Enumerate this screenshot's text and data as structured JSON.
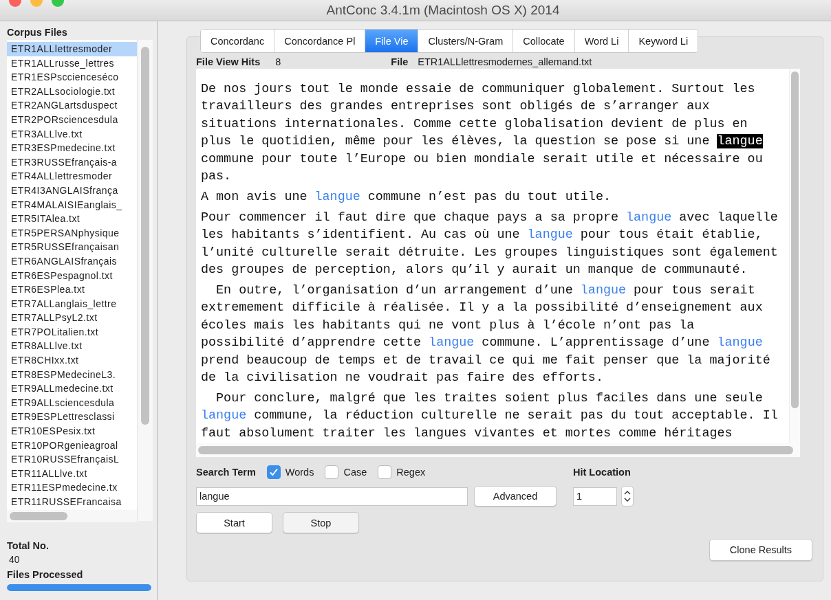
{
  "window": {
    "title": "AntConc 3.4.1m (Macintosh OS X) 2014"
  },
  "corpus_files": {
    "heading": "Corpus Files",
    "items": [
      {
        "name": "ETR1ALLlettresmoder",
        "selected": true
      },
      {
        "name": "ETR1ALLrusse_lettres",
        "selected": false
      },
      {
        "name": "ETR1ESPsccienceséco",
        "selected": false
      },
      {
        "name": "ETR2ALLsociologie.txt",
        "selected": false
      },
      {
        "name": "ETR2ANGLartsduspect",
        "selected": false
      },
      {
        "name": "ETR2PORsciencesdula",
        "selected": false
      },
      {
        "name": "ETR3ALLlve.txt",
        "selected": false
      },
      {
        "name": "ETR3ESPmedecine.txt",
        "selected": false
      },
      {
        "name": "ETR3RUSSEfrançais-a",
        "selected": false
      },
      {
        "name": "ETR4ALLlettresmoder",
        "selected": false
      },
      {
        "name": "ETR4I3ANGLAISfrança",
        "selected": false
      },
      {
        "name": "ETR4MALAISIEanglais_",
        "selected": false
      },
      {
        "name": "ETR5ITAlea.txt",
        "selected": false
      },
      {
        "name": "ETR5PERSANphysique",
        "selected": false
      },
      {
        "name": "ETR5RUSSEfrançaisan",
        "selected": false
      },
      {
        "name": "ETR6ANGLAISfrançais",
        "selected": false
      },
      {
        "name": "ETR6ESPespagnol.txt",
        "selected": false
      },
      {
        "name": "ETR6ESPlea.txt",
        "selected": false
      },
      {
        "name": "ETR7ALLanglais_lettre",
        "selected": false
      },
      {
        "name": "ETR7ALLPsyL2.txt",
        "selected": false
      },
      {
        "name": "ETR7POLitalien.txt",
        "selected": false
      },
      {
        "name": "ETR8ALLlve.txt",
        "selected": false
      },
      {
        "name": "ETR8CHIxx.txt",
        "selected": false
      },
      {
        "name": "ETR8ESPMedecineL3.",
        "selected": false
      },
      {
        "name": "ETR9ALLmedecine.txt",
        "selected": false
      },
      {
        "name": "ETR9ALLsciencesdula",
        "selected": false
      },
      {
        "name": "ETR9ESPLettresclassi",
        "selected": false
      },
      {
        "name": "ETR10ESPesix.txt",
        "selected": false
      },
      {
        "name": "ETR10PORgenieagroal",
        "selected": false
      },
      {
        "name": "ETR10RUSSEfrançaisL",
        "selected": false
      },
      {
        "name": "ETR11ALLlve.txt",
        "selected": false
      },
      {
        "name": "ETR11ESPmedecine.tx",
        "selected": false
      },
      {
        "name": "ETR11RUSSEFrancaisa",
        "selected": false
      }
    ]
  },
  "total": {
    "label": "Total No.",
    "value": "40"
  },
  "files_processed": {
    "label": "Files Processed",
    "level": 1
  },
  "tabs": [
    {
      "label": "Concordanc",
      "selected": false
    },
    {
      "label": "Concordance Pl",
      "selected": false
    },
    {
      "label": "File Vie",
      "selected": true
    },
    {
      "label": "Clusters/N-Gram",
      "selected": false
    },
    {
      "label": "Collocate",
      "selected": false
    },
    {
      "label": "Word Li",
      "selected": false
    },
    {
      "label": "Keyword Li",
      "selected": false
    }
  ],
  "file_view": {
    "hits_label": "File View Hits",
    "hits": "8",
    "file_label": "File",
    "file": "ETR1ALLlettresmodernes_allemand.txt",
    "paragraphs": [
      {
        "segments": [
          {
            "text": "De nos jours tout le monde essaie de communiquer globalement. Surtout les travailleurs des grandes entreprises sont obligés de s’arranger aux situations internationales. Comme cette globalisation devient de plus en plus le quotidien, même pour les élèves, la question se pose si une "
          },
          {
            "text": "langue",
            "hit": true,
            "selected": true
          },
          {
            "text": " commune pour toute l’Europe ou bien mondiale serait utile et nécessaire ou pas."
          }
        ]
      },
      {
        "segments": [
          {
            "text": "A mon avis une "
          },
          {
            "text": "langue",
            "hit": true,
            "selected": false
          },
          {
            "text": " commune n’est pas du tout utile."
          }
        ]
      },
      {
        "segments": [
          {
            "text": "Pour commencer il faut dire que chaque pays a sa propre "
          },
          {
            "text": "langue",
            "hit": true,
            "selected": false
          },
          {
            "text": " avec laquelle les habitants s’identifient. Au cas où une "
          },
          {
            "text": "langue",
            "hit": true,
            "selected": false
          },
          {
            "text": " pour tous était établie, l’unité culturelle serait détruite. Les groupes linguistiques sont également des groupes de perception, alors qu’il y aurait un manque de communauté."
          }
        ]
      },
      {
        "segments": [
          {
            "text": "  En outre, l’organisation d’un arrangement d’une "
          },
          {
            "text": "langue",
            "hit": true,
            "selected": false
          },
          {
            "text": " pour tous serait extremement difficile à réalisée. Il y a la possibilité d’enseignement aux écoles mais les habitants qui ne vont plus à l’école n’ont pas la possibilité d’apprendre cette "
          },
          {
            "text": "langue",
            "hit": true,
            "selected": false
          },
          {
            "text": " commune. L’apprentissage d’une "
          },
          {
            "text": "langue",
            "hit": true,
            "selected": false
          },
          {
            "text": " prend beaucoup de temps et de travail ce qui me fait penser que la majorité de la civilisation ne voudrait pas faire des efforts."
          }
        ]
      },
      {
        "segments": [
          {
            "text": "  Pour conclure, malgré que les traites soient plus faciles dans une seule "
          },
          {
            "text": "langue",
            "hit": true,
            "selected": false
          },
          {
            "text": " commune, la réduction culturelle ne serait pas du tout acceptable. Il faut absolument traiter les langues vivantes et mortes comme héritages"
          }
        ]
      }
    ]
  },
  "search": {
    "label": "Search Term",
    "options": [
      {
        "label": "Words",
        "checked": true
      },
      {
        "label": "Case",
        "checked": false
      },
      {
        "label": "Regex",
        "checked": false
      }
    ],
    "value": "langue",
    "advanced": "Advanced",
    "start": "Start",
    "stop": "Stop"
  },
  "hit_location": {
    "label": "Hit Location",
    "value": "1"
  },
  "clone_results": "Clone Results"
}
